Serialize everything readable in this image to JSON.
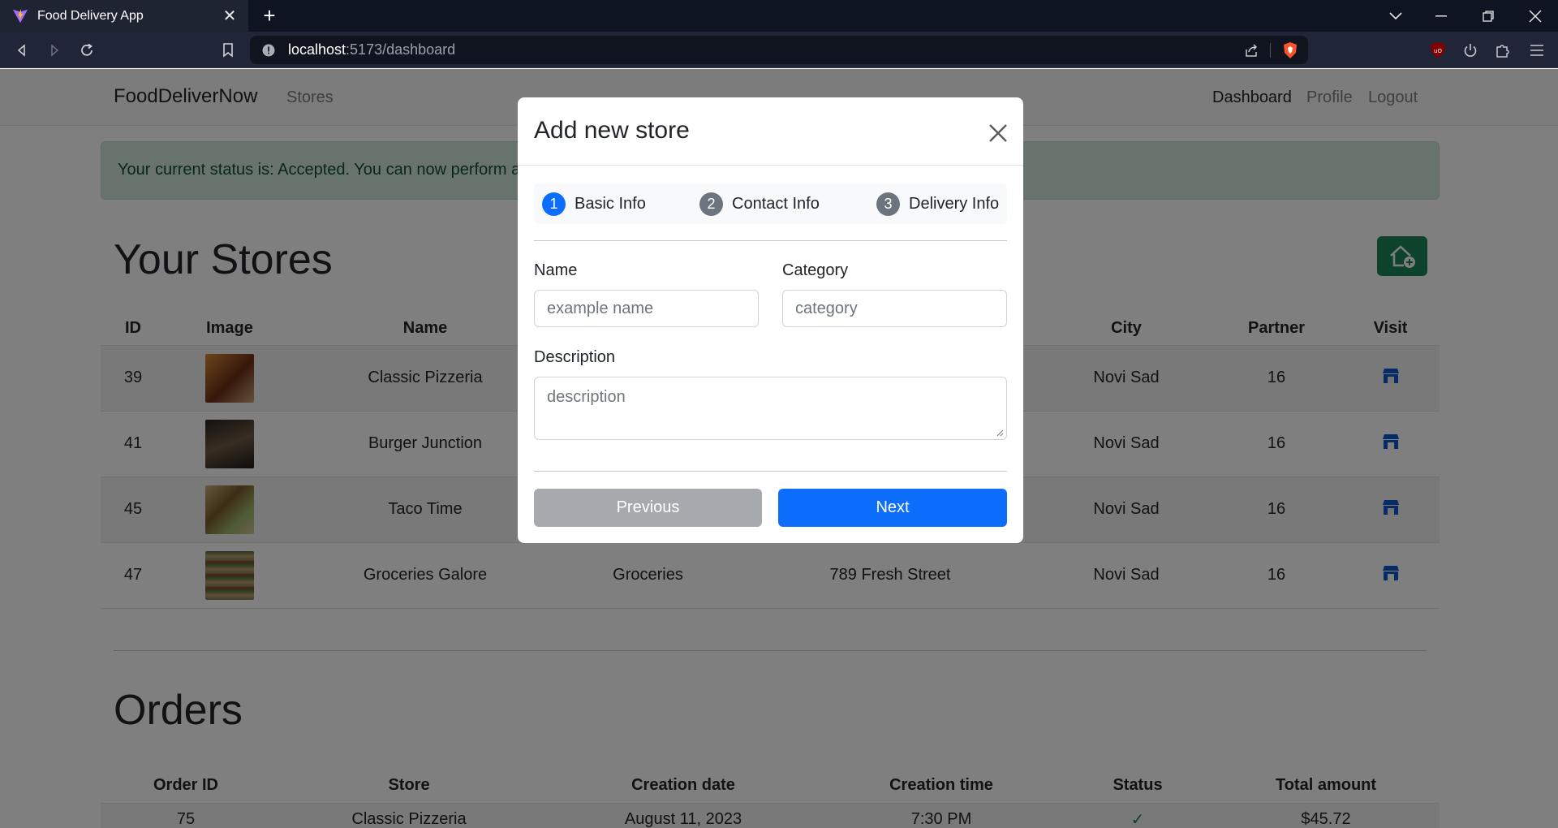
{
  "browser": {
    "tab_title": "Food Delivery App",
    "url_host": "localhost",
    "url_rest": ":5173/dashboard"
  },
  "navbar": {
    "brand": "FoodDeliverNow",
    "stores_link": "Stores",
    "dashboard_link": "Dashboard",
    "profile_link": "Profile",
    "logout_link": "Logout"
  },
  "alert": {
    "text": "Your current status is: Accepted. You can now perform a"
  },
  "stores": {
    "title": "Your Stores",
    "headers": [
      "ID",
      "Image",
      "Name",
      "City",
      "Partner",
      "Visit"
    ],
    "rows": [
      {
        "id": "39",
        "name": "Classic Pizzeria",
        "category": "",
        "address": "",
        "city": "Novi Sad",
        "partner": "16",
        "thumb_color": "#8a4b2a"
      },
      {
        "id": "41",
        "name": "Burger Junction",
        "category": "",
        "address": "",
        "city": "Novi Sad",
        "partner": "16",
        "thumb_color": "#3b2f2a"
      },
      {
        "id": "45",
        "name": "Taco Time",
        "category": "",
        "address": "",
        "city": "Novi Sad",
        "partner": "16",
        "thumb_color": "#a58a5a"
      },
      {
        "id": "47",
        "name": "Groceries Galore",
        "category": "Groceries",
        "address": "789 Fresh Street",
        "city": "Novi Sad",
        "partner": "16",
        "thumb_color": "#5c5d4a"
      }
    ]
  },
  "orders": {
    "title": "Orders",
    "headers": [
      "Order ID",
      "Store",
      "Creation date",
      "Creation time",
      "Status",
      "Total amount"
    ],
    "first_row": {
      "id": "75",
      "store": "Classic Pizzeria",
      "date": "August 11, 2023",
      "time": "7:30 PM",
      "status": "✓",
      "total": "$45.72"
    }
  },
  "modal": {
    "title": "Add new store",
    "steps": [
      {
        "num": "1",
        "label": "Basic Info",
        "color": "#0d6efd"
      },
      {
        "num": "2",
        "label": "Contact Info",
        "color": "#6c757d"
      },
      {
        "num": "3",
        "label": "Delivery Info",
        "color": "#6c757d"
      }
    ],
    "name_label": "Name",
    "name_placeholder": "example name",
    "category_label": "Category",
    "category_placeholder": "category",
    "description_label": "Description",
    "description_placeholder": "description",
    "previous_label": "Previous",
    "next_label": "Next"
  },
  "colors": {
    "primary": "#0d6efd",
    "success": "#198754",
    "secondary_disabled": "#a6aaae"
  }
}
